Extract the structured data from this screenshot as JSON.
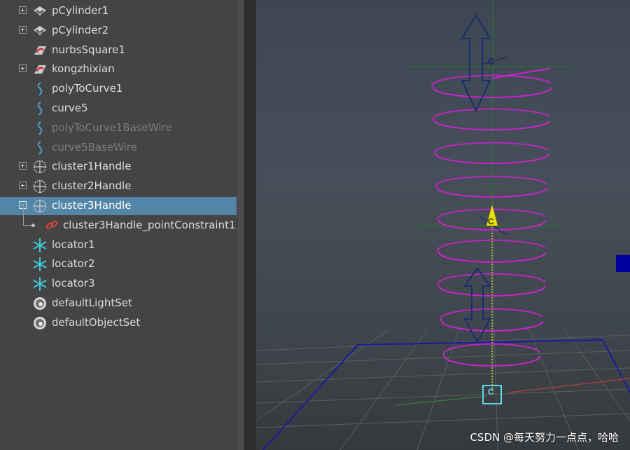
{
  "outliner": {
    "items": [
      {
        "label": "pCylinder1",
        "icon": "mesh-icon",
        "expander": "plus",
        "dim": false,
        "selected": false
      },
      {
        "label": "pCylinder2",
        "icon": "mesh-icon",
        "expander": "plus",
        "dim": false,
        "selected": false
      },
      {
        "label": "nurbsSquare1",
        "icon": "nurbs-surface-icon",
        "expander": "none",
        "dim": false,
        "selected": false
      },
      {
        "label": "kongzhixian",
        "icon": "nurbs-surface-icon",
        "expander": "plus",
        "dim": false,
        "selected": false
      },
      {
        "label": "polyToCurve1",
        "icon": "curve-icon",
        "expander": "none",
        "dim": false,
        "selected": false
      },
      {
        "label": "curve5",
        "icon": "curve-icon",
        "expander": "none",
        "dim": false,
        "selected": false
      },
      {
        "label": "polyToCurve1BaseWire",
        "icon": "curve-icon",
        "expander": "none",
        "dim": true,
        "selected": false
      },
      {
        "label": "curve5BaseWire",
        "icon": "curve-icon",
        "expander": "none",
        "dim": true,
        "selected": false
      },
      {
        "label": "cluster1Handle",
        "icon": "cluster-icon",
        "expander": "plus",
        "dim": false,
        "selected": false
      },
      {
        "label": "cluster2Handle",
        "icon": "cluster-icon",
        "expander": "plus",
        "dim": false,
        "selected": false
      },
      {
        "label": "cluster3Handle",
        "icon": "cluster-icon",
        "expander": "minus",
        "dim": false,
        "selected": true
      },
      {
        "label": "cluster3Handle_pointConstraint1",
        "icon": "constraint-link-icon",
        "expander": "child",
        "dim": false,
        "selected": false
      },
      {
        "label": "locator1",
        "icon": "locator-icon",
        "expander": "none",
        "dim": false,
        "selected": false
      },
      {
        "label": "locator2",
        "icon": "locator-icon",
        "expander": "none",
        "dim": false,
        "selected": false
      },
      {
        "label": "locator3",
        "icon": "locator-icon",
        "expander": "none",
        "dim": false,
        "selected": false
      },
      {
        "label": "defaultLightSet",
        "icon": "set-icon",
        "expander": "none",
        "dim": false,
        "selected": false
      },
      {
        "label": "defaultObjectSet",
        "icon": "set-icon",
        "expander": "none",
        "dim": false,
        "selected": false
      }
    ]
  },
  "viewport": {
    "helix_color": "#cc22cc",
    "handle_labels": [
      "C",
      "C",
      "C"
    ]
  },
  "colors": {
    "selection": "#5285a6",
    "panel": "#444444",
    "text": "#dcdcdc",
    "dim_text": "#7c7c7c"
  },
  "watermark": "CSDN @每天努力一点点，哈哈"
}
